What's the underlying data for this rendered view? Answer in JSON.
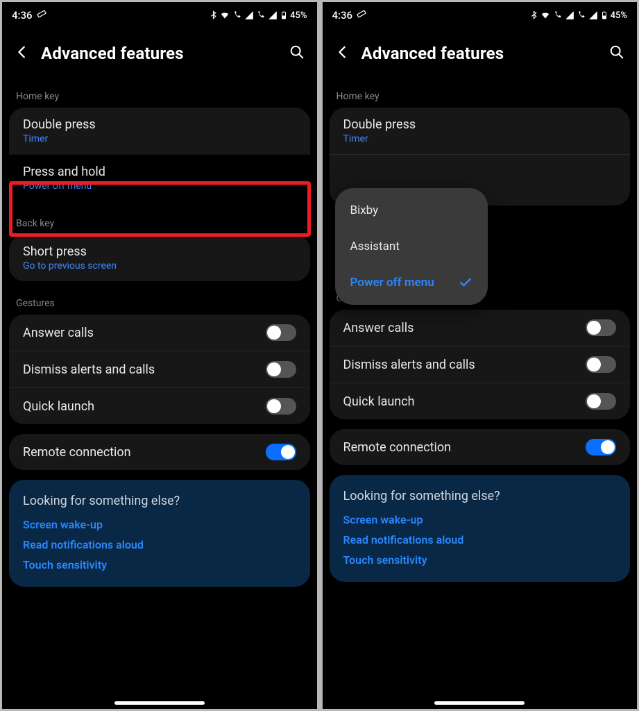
{
  "status": {
    "time": "4:36",
    "battery": "45%"
  },
  "header": {
    "title": "Advanced features"
  },
  "sections": {
    "home_key": "Home key",
    "back_key": "Back key",
    "gestures": "Gestures"
  },
  "left": {
    "double_press": {
      "title": "Double press",
      "sub": "Timer"
    },
    "press_hold": {
      "title": "Press and hold",
      "sub": "Power off menu"
    },
    "short_press": {
      "title": "Short press",
      "sub": "Go to previous screen"
    }
  },
  "right": {
    "double_press": {
      "title": "Double press",
      "sub": "Timer"
    },
    "popup": {
      "opt1": "Bixby",
      "opt2": "Assistant",
      "opt3": "Power off menu"
    }
  },
  "gestures": {
    "answer_calls": "Answer calls",
    "dismiss": "Dismiss alerts and calls",
    "quick_launch": "Quick launch"
  },
  "remote": "Remote connection",
  "suggest": {
    "title": "Looking for something else?",
    "l1": "Screen wake-up",
    "l2": "Read notifications aloud",
    "l3": "Touch sensitivity"
  }
}
